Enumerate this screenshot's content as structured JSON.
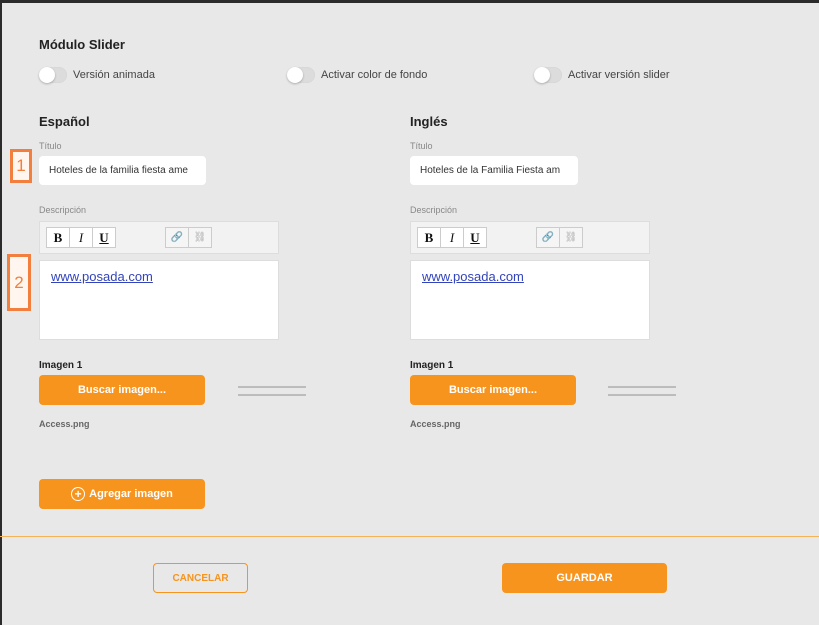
{
  "module": {
    "title": "Módulo Slider"
  },
  "toggles": [
    {
      "label": "Versión animada",
      "on": false
    },
    {
      "label": "Activar color de fondo",
      "on": false
    },
    {
      "label": "Activar versión slider",
      "on": false
    }
  ],
  "markers": [
    "1",
    "2"
  ],
  "columns": {
    "es": {
      "heading": "Español",
      "title_label": "Título",
      "title_value": "Hoteles de la familia fiesta ame",
      "desc_label": "Descripción",
      "desc_link": "www.posada.com",
      "image_label": "Imagen 1",
      "search_button": "Buscar imagen...",
      "file_name": "Access.png"
    },
    "en": {
      "heading": "Inglés",
      "title_label": "Título",
      "title_value": "Hoteles de la Familia Fiesta am",
      "desc_label": "Descripción",
      "desc_link": "www.posada.com",
      "image_label": "Imagen 1",
      "search_button": "Buscar imagen...",
      "file_name": "Access.png"
    }
  },
  "toolbar": {
    "bold": "B",
    "italic": "I",
    "underline": "U",
    "link": "🔗",
    "unlink": "⛓"
  },
  "add_image_button": "Agregar imagen",
  "footer": {
    "cancel": "CANCELAR",
    "save": "GUARDAR"
  },
  "colors": {
    "accent": "#f7941d",
    "marker": "#f27f3d"
  }
}
